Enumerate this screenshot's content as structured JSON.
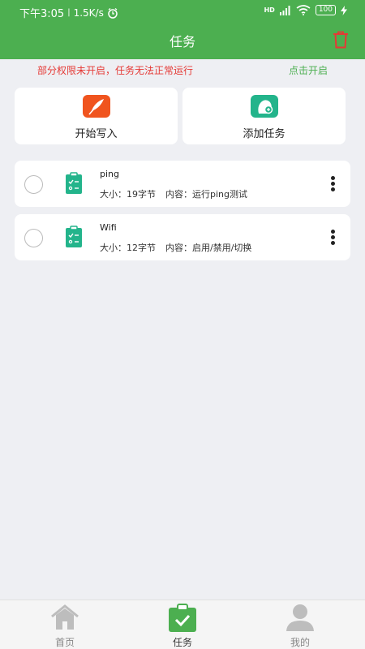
{
  "status_bar": {
    "time": "下午3:05",
    "speed": "1.5K/s",
    "hd": "HD",
    "battery": "100"
  },
  "header": {
    "title": "任务"
  },
  "warning": {
    "text": "部分权限未开启，任务无法正常运行",
    "link": "点击开启"
  },
  "actions": [
    {
      "label": "开始写入",
      "icon": "write-pen-icon"
    },
    {
      "label": "添加任务",
      "icon": "add-task-icon"
    }
  ],
  "tasks": [
    {
      "name": "ping",
      "size_label": "大小：",
      "size": "19字节",
      "content_label": "内容：",
      "content": "运行ping测试"
    },
    {
      "name": "Wifi",
      "size_label": "大小：",
      "size": "12字节",
      "content_label": "内容：",
      "content": "启用/禁用/切换"
    }
  ],
  "bottom_nav": [
    {
      "label": "首页",
      "icon": "home-icon",
      "active": false
    },
    {
      "label": "任务",
      "icon": "clipboard-check-icon",
      "active": true
    },
    {
      "label": "我的",
      "icon": "profile-icon",
      "active": false
    }
  ],
  "colors": {
    "primary": "#4caf50",
    "warning": "#e53935",
    "teal": "#23b48b",
    "orange": "#f0541e"
  }
}
